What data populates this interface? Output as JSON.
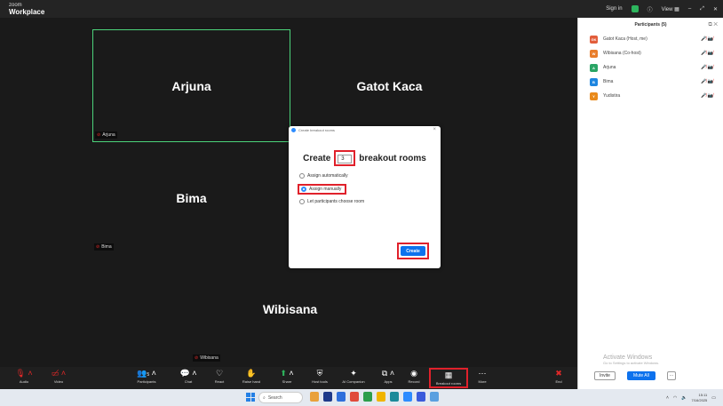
{
  "titlebar": {
    "logo_top": "zoom",
    "logo_bottom": "Workplace",
    "signin": "Sign in",
    "view": "View ▦",
    "minimize": "–",
    "maximize": "⤢",
    "close": "✕"
  },
  "tiles": {
    "arjuna": {
      "name": "Arjuna",
      "label": "Arjuna"
    },
    "gatot": {
      "name": "Gatot Kaca"
    },
    "bima": {
      "name": "Bima",
      "label": "Bima"
    },
    "wibisana": {
      "name": "Wibisana",
      "label": "Wibisana"
    }
  },
  "dialog": {
    "title": "Create breakout rooms",
    "create_word": "Create",
    "count": "3",
    "rooms_word": "breakout rooms",
    "options": [
      "Assign automatically",
      "Assign manually",
      "Let participants choose room"
    ],
    "selected_option": "Assign manually",
    "create_button": "Create",
    "close": "×"
  },
  "panel": {
    "title": "Participants (5)",
    "participants": [
      {
        "initials": "GK",
        "name": "Gatot Kaca (Host, me)",
        "color": "#e25d3b"
      },
      {
        "initials": "W",
        "name": "Wibisana (Co-host)",
        "color": "#e97d2a"
      },
      {
        "initials": "A",
        "name": "Arjuna",
        "color": "#2aa565"
      },
      {
        "initials": "B",
        "name": "Bima",
        "color": "#1e86e0"
      },
      {
        "initials": "Y",
        "name": "Yudistira",
        "color": "#e98a1b"
      }
    ],
    "status_icons": "🎤̸ 📷̸",
    "activate_title": "Activate Windows",
    "activate_sub": "Go to Settings to activate Windows.",
    "invite": "Invite",
    "mute_all": "Mute All",
    "more": "···"
  },
  "toolbar": {
    "audio": "Audio",
    "video": "Video",
    "participants": "Participants",
    "participants_count": "5",
    "chat": "Chat",
    "react": "React",
    "raise_hand": "Raise hand",
    "share": "Share",
    "host_tools": "Host tools",
    "ai_companion": "AI Companion",
    "apps": "Apps",
    "record": "Record",
    "breakout_rooms": "Breakout rooms",
    "more": "More",
    "end": "End"
  },
  "taskbar": {
    "search": "Search",
    "time": "15:11",
    "date": "7/16/2025"
  }
}
